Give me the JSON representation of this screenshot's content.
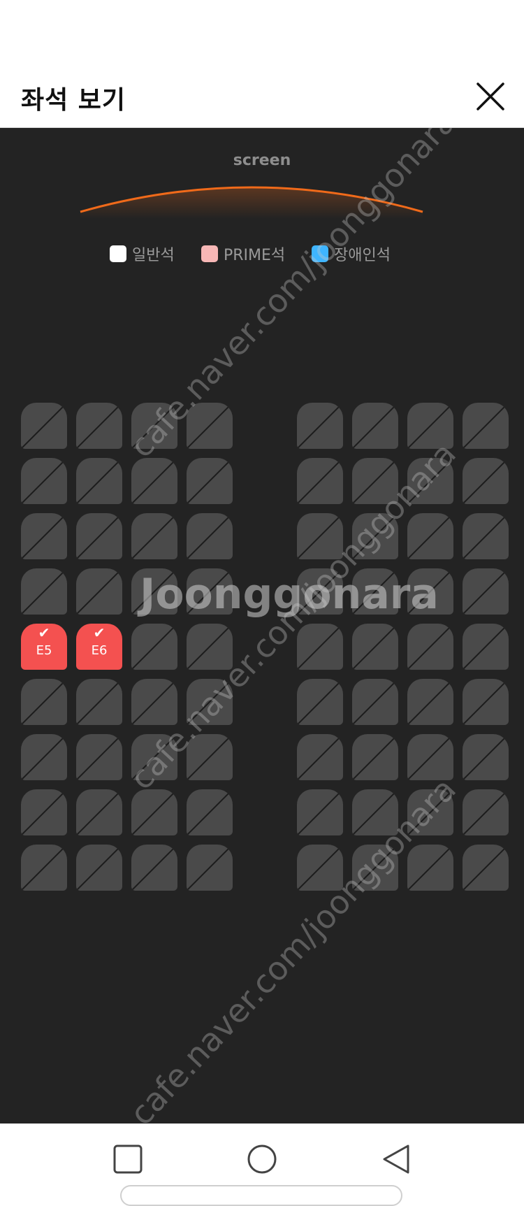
{
  "header": {
    "title": "좌석 보기",
    "close_icon": "close-icon"
  },
  "screen": {
    "label": "screen",
    "glow_color": "#f06a1a"
  },
  "legend": [
    {
      "label": "일반석",
      "color": "#ffffff"
    },
    {
      "label": "PRIME석",
      "color": "#f7b7b6"
    },
    {
      "label": "장애인석",
      "color": "#3fb5ff"
    }
  ],
  "seats": {
    "rows": 9,
    "seats_per_block": 4,
    "blocks": 2,
    "unavailable_color": "#4a4a4a",
    "selected_color": "#f45150",
    "selected": [
      {
        "label": "E5",
        "row": 4,
        "col": 0
      },
      {
        "label": "E6",
        "row": 4,
        "col": 1
      }
    ]
  },
  "watermark": {
    "text": "cafe.naver.com/joonggonara",
    "logo": "Joonggonara"
  },
  "nav": {
    "recent_icon": "square-icon",
    "home_icon": "circle-icon",
    "back_icon": "triangle-back-icon"
  }
}
